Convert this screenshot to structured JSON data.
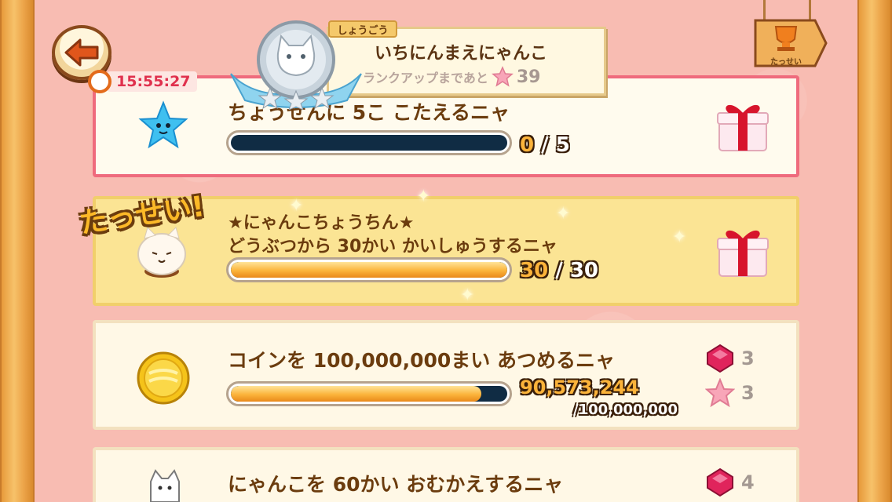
{
  "timer": {
    "text": "15:55:27"
  },
  "title_badge": {
    "tag": "しょうごう",
    "name": "いちにんまえにゃんこ",
    "rank_up_label": "ランクアップまであと",
    "rank_up_count": "39"
  },
  "trophy_button": {
    "label": "たっせい"
  },
  "missions": [
    {
      "text": "ちょうせんに 5こ こたえるニャ",
      "current": "0",
      "separator": "/",
      "total": "5",
      "progress": 0
    },
    {
      "badge": "たっせい!",
      "line1": "★にゃんこちょうちん★",
      "line2": "どうぶつから 30かい かいしゅうするニャ",
      "current": "30",
      "separator": "/",
      "total": "30",
      "progress": 1.0
    },
    {
      "text": "コインを 100,000,000まい あつめるニャ",
      "current": "90,573,244",
      "total_line": "/100,000,000",
      "progress": 0.905,
      "rewards": [
        {
          "icon": "gem-icon",
          "count": "3"
        },
        {
          "icon": "star-icon",
          "count": "3"
        }
      ]
    },
    {
      "text": "にゃんこを 60かい おむかえするニャ",
      "rewards": [
        {
          "icon": "gem-icon",
          "count": "4"
        }
      ]
    }
  ],
  "colors": {
    "accent_pink": "#ef6b7d",
    "progress_fill": "#fbb43b",
    "progress_track": "#102c44",
    "text_brown": "#6b3c0e"
  }
}
